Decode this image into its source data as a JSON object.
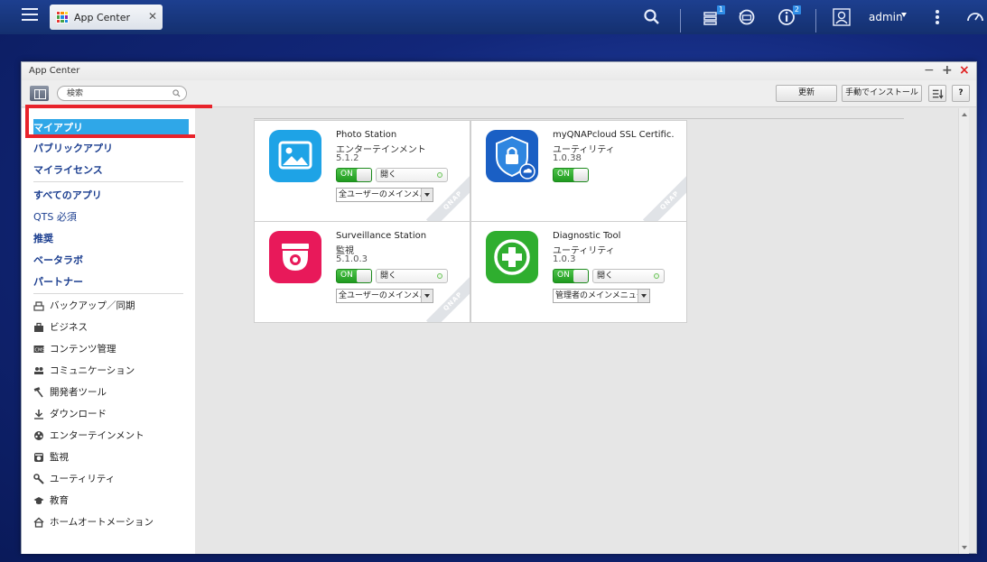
{
  "taskbar": {
    "tab_label": "App Center",
    "close_glyph": "✕",
    "notification_badge": "1",
    "info_badge": "2",
    "user_label": "admin"
  },
  "window": {
    "title": "App Center",
    "minimize_glyph": "−",
    "maximize_glyph": "+",
    "close_glyph": "×"
  },
  "toolbar": {
    "search_placeholder": "検索",
    "update_label": "更新",
    "manual_install_label": "手動でインストール",
    "help_label": "?"
  },
  "sidebar": {
    "top_items": [
      "マイアプリ",
      "パブリックアプリ",
      "マイライセンス"
    ],
    "group_items": [
      "すべてのアプリ",
      "QTS 必須",
      "推奨",
      "ベータラボ",
      "パートナー"
    ],
    "categories": [
      {
        "label": "バックアップ／同期",
        "icon": "backup-icon"
      },
      {
        "label": "ビジネス",
        "icon": "briefcase-icon"
      },
      {
        "label": "コンテンツ管理",
        "icon": "cms-icon"
      },
      {
        "label": "コミュニケーション",
        "icon": "people-icon"
      },
      {
        "label": "開発者ツール",
        "icon": "hammer-icon"
      },
      {
        "label": "ダウンロード",
        "icon": "download-icon"
      },
      {
        "label": "エンターテインメント",
        "icon": "film-reel-icon"
      },
      {
        "label": "監視",
        "icon": "camera-icon"
      },
      {
        "label": "ユーティリティ",
        "icon": "wrench-icon"
      },
      {
        "label": "教育",
        "icon": "graduation-cap-icon"
      },
      {
        "label": "ホームオートメーション",
        "icon": "home-icon"
      }
    ]
  },
  "apps": [
    {
      "name": "Photo Station",
      "category": "エンターテインメント",
      "version": "5.1.2",
      "toggle": "ON",
      "open_label": "開く",
      "menu_select": "全ユーザーのメインメニュー",
      "icon": "photo-icon",
      "color": "#1ea3e6"
    },
    {
      "name": "myQNAPcloud SSL Certific...",
      "category": "ユーティリティ",
      "version": "1.0.38",
      "toggle": "ON",
      "icon": "shield-lock-icon",
      "color": "#1a5fc4"
    },
    {
      "name": "Surveillance Station",
      "category": "監視",
      "version": "5.1.0.3",
      "toggle": "ON",
      "open_label": "開く",
      "menu_select": "全ユーザーのメインメニュー",
      "icon": "dome-camera-icon",
      "color": "#e8195a"
    },
    {
      "name": "Diagnostic Tool",
      "category": "ユーティリティ",
      "version": "1.0.3",
      "toggle": "ON",
      "open_label": "開く",
      "menu_select": "管理者のメインメニュー",
      "icon": "medical-cross-icon",
      "color": "#2fae2f"
    }
  ],
  "ribbon_text": "QNAP",
  "colors": {
    "accent_selected": "#2fa7e8",
    "highlight_box": "#e8232b",
    "toggle_on": "#2fae2f"
  }
}
